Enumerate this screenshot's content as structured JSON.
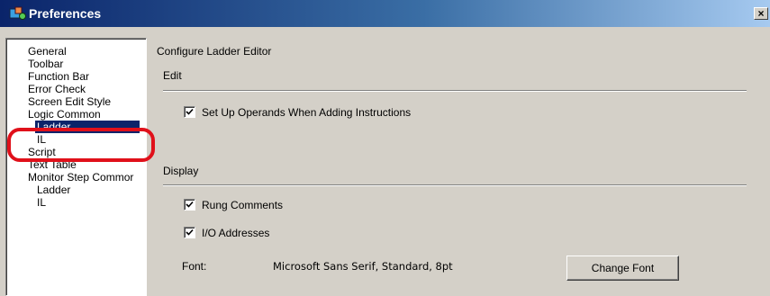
{
  "window": {
    "title": "Preferences",
    "close_glyph": "×",
    "icon": "app-preferences-icon"
  },
  "sidebar": {
    "items": [
      {
        "label": "General",
        "selected": false
      },
      {
        "label": "Toolbar",
        "selected": false
      },
      {
        "label": "Function Bar",
        "selected": false
      },
      {
        "label": "Error Check",
        "selected": false
      },
      {
        "label": "Screen Edit Style",
        "selected": false
      },
      {
        "label": "Logic Common",
        "selected": false
      },
      {
        "label": "Ladder",
        "selected": true
      },
      {
        "label": "IL",
        "selected": false
      },
      {
        "label": "Script",
        "selected": false
      },
      {
        "label": "Text Table",
        "selected": false
      },
      {
        "label": "Monitor Step Commor",
        "selected": false
      },
      {
        "label": "Ladder",
        "selected": false
      },
      {
        "label": "IL",
        "selected": false
      }
    ]
  },
  "content": {
    "title": "Configure Ladder Editor",
    "edit": {
      "label": "Edit",
      "set_up_operands": {
        "label": "Set Up Operands When Adding Instructions",
        "checked": true
      }
    },
    "display": {
      "label": "Display",
      "rung_comments": {
        "label": "Rung Comments",
        "checked": true
      },
      "io_addresses": {
        "label": "I/O Addresses",
        "checked": true
      },
      "font_label": "Font:",
      "font_value": "Microsoft Sans Serif, Standard, 8pt",
      "change_font_label": "Change Font"
    }
  },
  "colors": {
    "selection": "#0a246a",
    "highlight_ring": "#e0101a",
    "dialog_background": "#d4d0c8"
  }
}
